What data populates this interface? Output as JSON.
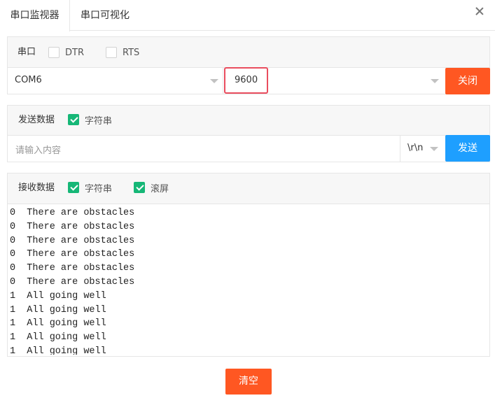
{
  "tabs": [
    {
      "label": "串口监视器",
      "active": true
    },
    {
      "label": "串口可视化",
      "active": false
    }
  ],
  "serial": {
    "title": "串口",
    "dtr_label": "DTR",
    "dtr_checked": false,
    "rts_label": "RTS",
    "rts_checked": false,
    "port_value": "COM6",
    "baud_value": "9600",
    "close_button": "关闭"
  },
  "send": {
    "title": "发送数据",
    "string_label": "字符串",
    "string_checked": true,
    "input_placeholder": "请输入内容",
    "line_ending": "\\r\\n",
    "send_button": "发送"
  },
  "receive": {
    "title": "接收数据",
    "string_label": "字符串",
    "string_checked": true,
    "scroll_label": "滚屏",
    "scroll_checked": true,
    "lines": [
      "0  There are obstacles",
      "0  There are obstacles",
      "0  There are obstacles",
      "0  There are obstacles",
      "0  There are obstacles",
      "0  There are obstacles",
      "1  All going well",
      "1  All going well",
      "1  All going well",
      "1  All going well",
      "1  All going well"
    ]
  },
  "clear_button": "清空",
  "colors": {
    "accent_orange": "#ff5722",
    "accent_blue": "#1e9fff",
    "check_green": "#16b777",
    "highlight_red": "#e94d5e"
  }
}
